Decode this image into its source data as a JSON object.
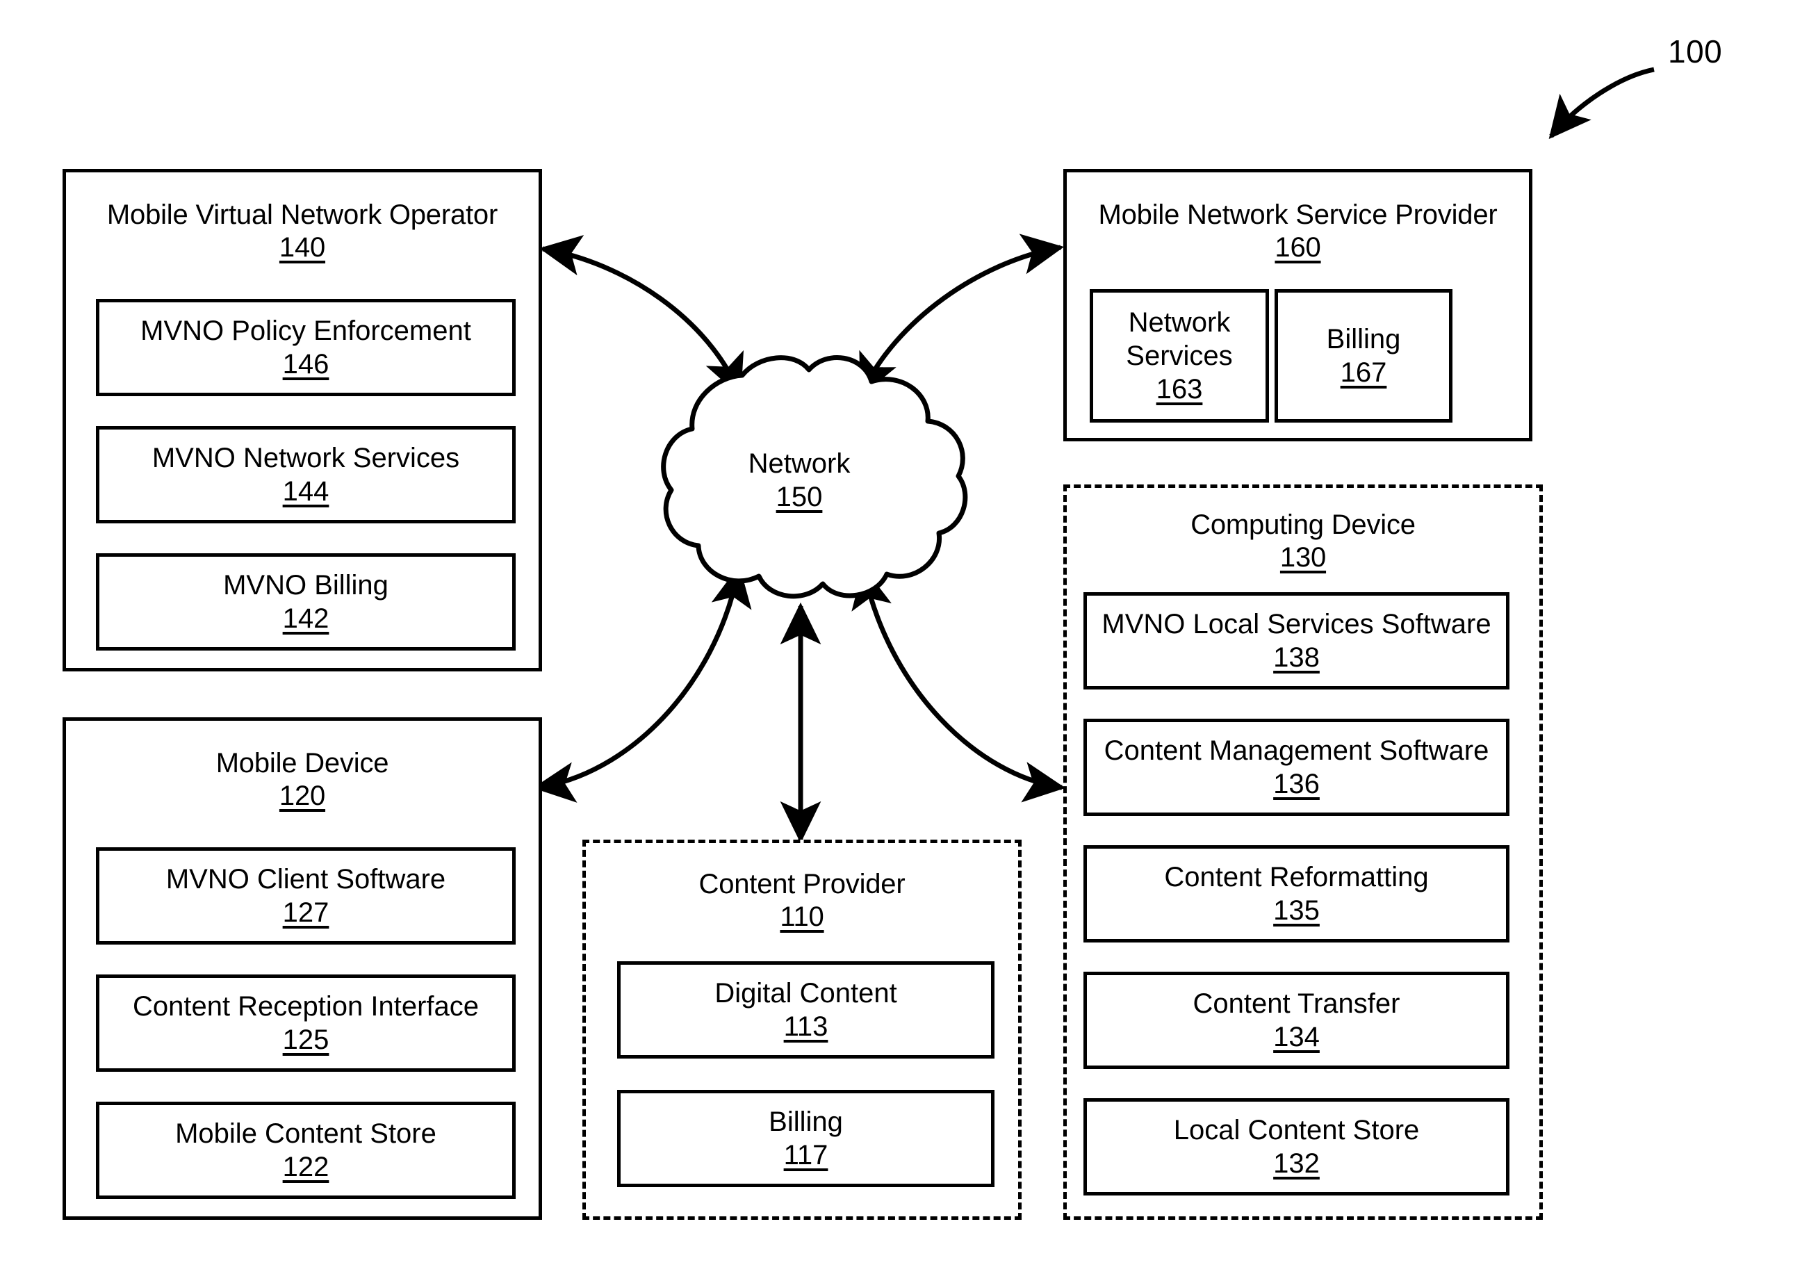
{
  "figure": {
    "reference_numeral": "100"
  },
  "nodes": {
    "mvno": {
      "title": "Mobile Virtual Network Operator",
      "ref": "140",
      "children": [
        {
          "label": "MVNO Policy Enforcement",
          "ref": "146"
        },
        {
          "label": "MVNO Network Services",
          "ref": "144"
        },
        {
          "label": "MVNO Billing",
          "ref": "142"
        }
      ]
    },
    "mobile_device": {
      "title": "Mobile Device",
      "ref": "120",
      "children": [
        {
          "label": "MVNO Client Software",
          "ref": "127"
        },
        {
          "label": "Content Reception Interface",
          "ref": "125"
        },
        {
          "label": "Mobile Content Store",
          "ref": "122"
        }
      ]
    },
    "network": {
      "title": "Network",
      "ref": "150"
    },
    "content_provider": {
      "title": "Content Provider",
      "ref": "110",
      "children": [
        {
          "label": "Digital Content",
          "ref": "113"
        },
        {
          "label": "Billing",
          "ref": "117"
        }
      ]
    },
    "mnsp": {
      "title": "Mobile Network Service Provider",
      "ref": "160",
      "children": [
        {
          "label": "Network Services",
          "ref": "163"
        },
        {
          "label": "Billing",
          "ref": "167"
        }
      ]
    },
    "computing_device": {
      "title": "Computing Device",
      "ref": "130",
      "children": [
        {
          "label": "MVNO Local Services Software",
          "ref": "138"
        },
        {
          "label": "Content Management Software",
          "ref": "136"
        },
        {
          "label": "Content Reformatting",
          "ref": "135"
        },
        {
          "label": "Content Transfer",
          "ref": "134"
        },
        {
          "label": "Local Content Store",
          "ref": "132"
        }
      ]
    }
  },
  "colors": {
    "stroke": "#000000",
    "background": "#ffffff"
  }
}
